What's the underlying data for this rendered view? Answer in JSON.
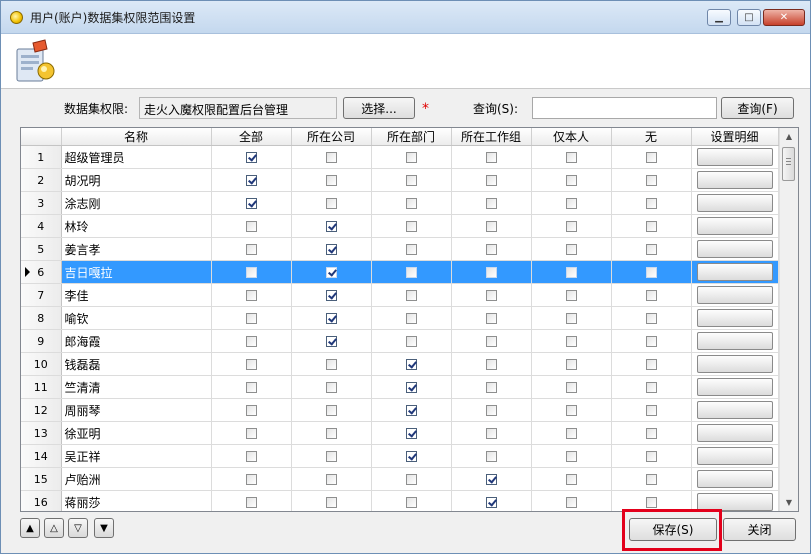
{
  "window": {
    "title": "用户(账户)数据集权限范围设置"
  },
  "filter": {
    "perm_label": "数据集权限:",
    "perm_value": "走火入魔权限配置后台管理",
    "select_button": "选择...",
    "required_mark": "*",
    "query_label": "查询(S):",
    "query_value": "",
    "query_button": "查询(F)"
  },
  "table": {
    "columns": [
      "名称",
      "全部",
      "所在公司",
      "所在部门",
      "所在工作组",
      "仅本人",
      "无",
      "设置明细"
    ],
    "selected_row": 6,
    "rows": [
      {
        "no": "1",
        "name": "超级管理员",
        "checks": [
          true,
          false,
          false,
          false,
          false,
          false
        ]
      },
      {
        "no": "2",
        "name": "胡况明",
        "checks": [
          true,
          false,
          false,
          false,
          false,
          false
        ]
      },
      {
        "no": "3",
        "name": "涂志刚",
        "checks": [
          true,
          false,
          false,
          false,
          false,
          false
        ]
      },
      {
        "no": "4",
        "name": "林玲",
        "checks": [
          false,
          true,
          false,
          false,
          false,
          false
        ]
      },
      {
        "no": "5",
        "name": "姜言孝",
        "checks": [
          false,
          true,
          false,
          false,
          false,
          false
        ]
      },
      {
        "no": "6",
        "name": "吉日嘎拉",
        "checks": [
          false,
          true,
          false,
          false,
          false,
          false
        ]
      },
      {
        "no": "7",
        "name": "李佳",
        "checks": [
          false,
          true,
          false,
          false,
          false,
          false
        ]
      },
      {
        "no": "8",
        "name": "喻钦",
        "checks": [
          false,
          true,
          false,
          false,
          false,
          false
        ]
      },
      {
        "no": "9",
        "name": "郎海霞",
        "checks": [
          false,
          true,
          false,
          false,
          false,
          false
        ]
      },
      {
        "no": "10",
        "name": "钱磊磊",
        "checks": [
          false,
          false,
          true,
          false,
          false,
          false
        ]
      },
      {
        "no": "11",
        "name": "竺清清",
        "checks": [
          false,
          false,
          true,
          false,
          false,
          false
        ]
      },
      {
        "no": "12",
        "name": "周丽琴",
        "checks": [
          false,
          false,
          true,
          false,
          false,
          false
        ]
      },
      {
        "no": "13",
        "name": "徐亚明",
        "checks": [
          false,
          false,
          true,
          false,
          false,
          false
        ]
      },
      {
        "no": "14",
        "name": "吴正祥",
        "checks": [
          false,
          false,
          true,
          false,
          false,
          false
        ]
      },
      {
        "no": "15",
        "name": "卢贻洲",
        "checks": [
          false,
          false,
          false,
          true,
          false,
          false
        ]
      },
      {
        "no": "16",
        "name": "蒋丽莎",
        "checks": [
          false,
          false,
          false,
          true,
          false,
          false
        ]
      }
    ]
  },
  "footer": {
    "save_button": "保存(S)",
    "close_button": "关闭"
  },
  "icons": {
    "nav": [
      "move-top-icon",
      "move-up-icon",
      "move-down-icon",
      "move-bottom-icon"
    ]
  },
  "colors": {
    "selection": "#3399ff",
    "highlight_box": "#e3001b"
  }
}
